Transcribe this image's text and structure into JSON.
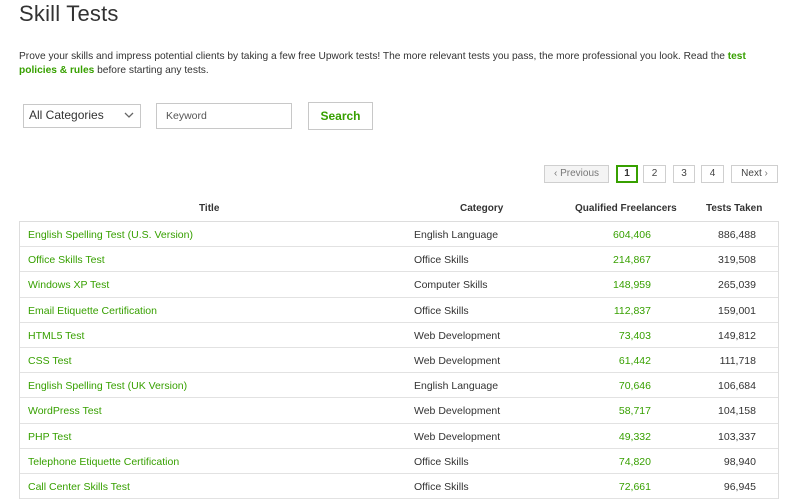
{
  "page": {
    "title": "Skill Tests",
    "intro_text": "Prove your skills and impress potential clients by taking a few free Upwork tests! The more relevant tests you pass, the more professional you look. Read the ",
    "intro_link": "test policies & rules",
    "intro_text_after": " before starting any tests."
  },
  "filters": {
    "category_selected": "All Categories",
    "keyword_placeholder": "Keyword",
    "keyword_value": "",
    "search_label": "Search"
  },
  "pagination": {
    "previous_label": "Previous",
    "pages": [
      "1",
      "2",
      "3",
      "4"
    ],
    "current_page": "1",
    "next_label": "Next"
  },
  "table": {
    "headers": {
      "title": "Title",
      "category": "Category",
      "qualified": "Qualified Freelancers",
      "taken": "Tests Taken"
    },
    "rows": [
      {
        "title": "English Spelling Test (U.S. Version)",
        "category": "English Language",
        "qualified": "604,406",
        "taken": "886,488"
      },
      {
        "title": "Office Skills Test",
        "category": "Office Skills",
        "qualified": "214,867",
        "taken": "319,508"
      },
      {
        "title": "Windows XP Test",
        "category": "Computer Skills",
        "qualified": "148,959",
        "taken": "265,039"
      },
      {
        "title": "Email Etiquette Certification",
        "category": "Office Skills",
        "qualified": "112,837",
        "taken": "159,001"
      },
      {
        "title": "HTML5 Test",
        "category": "Web Development",
        "qualified": "73,403",
        "taken": "149,812"
      },
      {
        "title": "CSS Test",
        "category": "Web Development",
        "qualified": "61,442",
        "taken": "111,718"
      },
      {
        "title": "English Spelling Test (UK Version)",
        "category": "English Language",
        "qualified": "70,646",
        "taken": "106,684"
      },
      {
        "title": "WordPress Test",
        "category": "Web Development",
        "qualified": "58,717",
        "taken": "104,158"
      },
      {
        "title": "PHP Test",
        "category": "Web Development",
        "qualified": "49,332",
        "taken": "103,337"
      },
      {
        "title": "Telephone Etiquette Certification",
        "category": "Office Skills",
        "qualified": "74,820",
        "taken": "98,940"
      },
      {
        "title": "Call Center Skills Test",
        "category": "Office Skills",
        "qualified": "72,661",
        "taken": "96,945"
      }
    ]
  },
  "colors": {
    "accent": "#37a000",
    "text": "#333333",
    "border": "#dddddd"
  }
}
